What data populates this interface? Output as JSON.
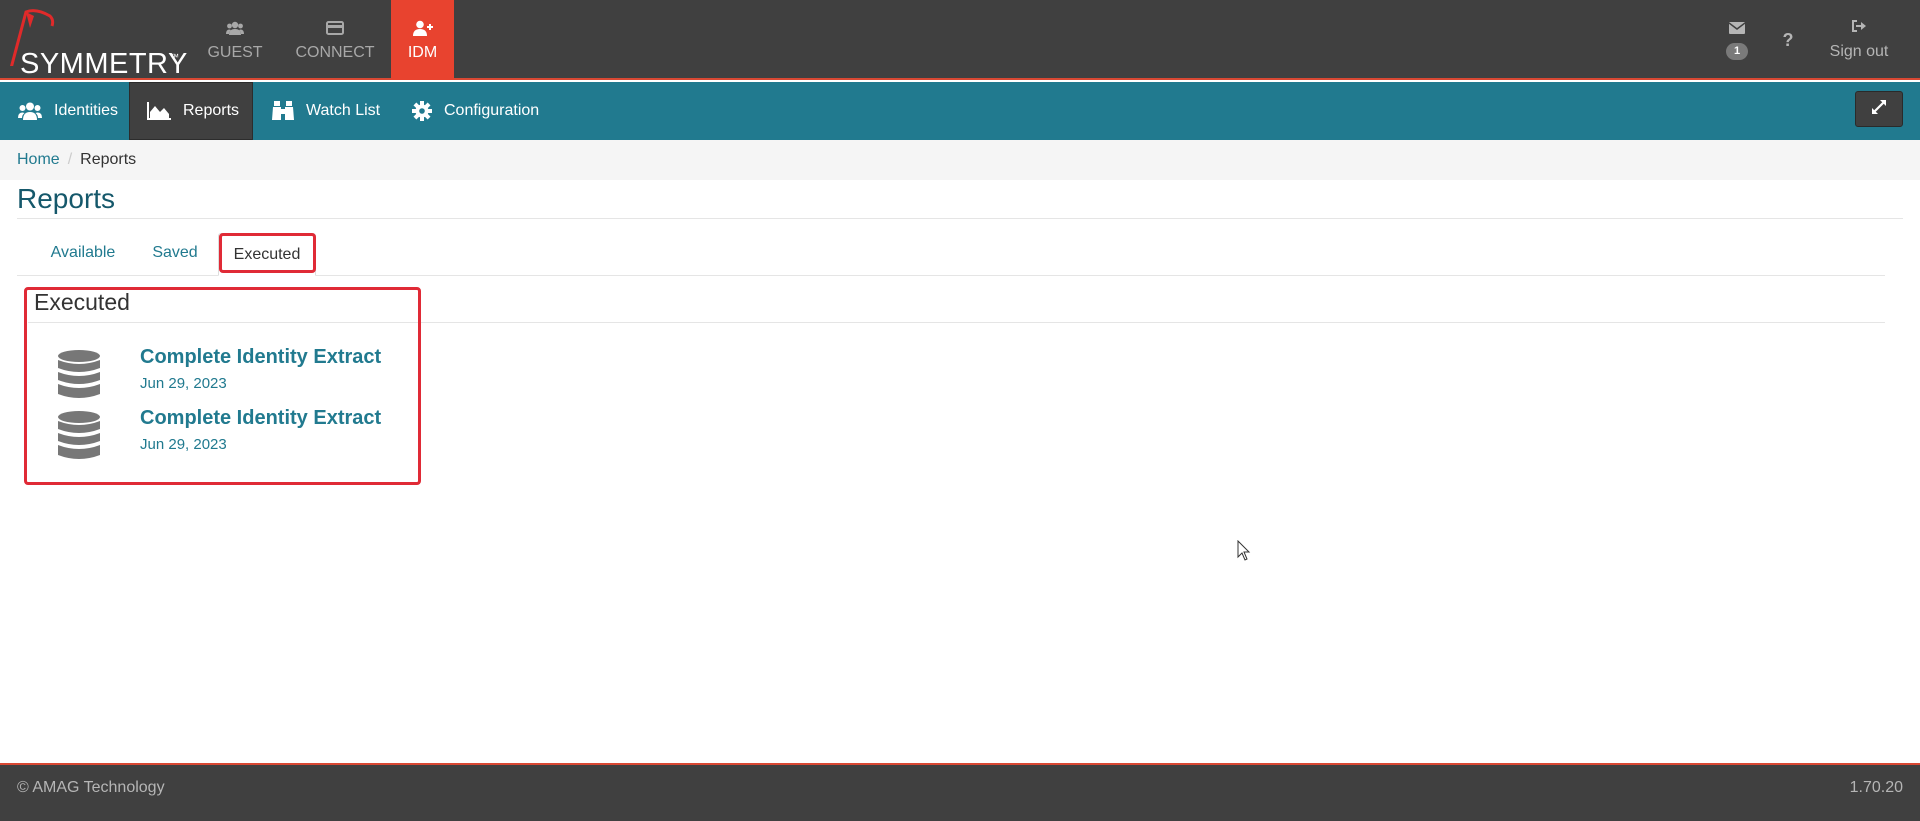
{
  "brand": {
    "name": "SYMMETRY",
    "tm": "™",
    "accent": "#d94833"
  },
  "app_tabs": [
    {
      "label": "GUEST",
      "icon": "users-icon",
      "active": false
    },
    {
      "label": "CONNECT",
      "icon": "card-icon",
      "active": false
    },
    {
      "label": "IDM",
      "icon": "user-plus-icon",
      "active": true
    }
  ],
  "top_right": {
    "messages_icon": "envelope-icon",
    "messages_count": "1",
    "help_label": "?",
    "signout_label": "Sign out",
    "signout_icon": "sign-out-icon"
  },
  "nav": {
    "items": [
      {
        "label": "Identities",
        "icon": "users-icon",
        "active": false
      },
      {
        "label": "Reports",
        "icon": "area-chart-icon",
        "active": true
      },
      {
        "label": "Watch List",
        "icon": "binoculars-icon",
        "active": false
      },
      {
        "label": "Configuration",
        "icon": "gear-icon",
        "active": false
      }
    ],
    "expand_icon": "expand-icon",
    "color": "#217a8f"
  },
  "breadcrumb": {
    "home": "Home",
    "separator": "/",
    "current": "Reports"
  },
  "page": {
    "title": "Reports"
  },
  "tabs": [
    {
      "label": "Available",
      "active": false
    },
    {
      "label": "Saved",
      "active": false
    },
    {
      "label": "Executed",
      "active": true
    }
  ],
  "section": {
    "title": "Executed",
    "items": [
      {
        "name": "Complete Identity Extract",
        "date": "Jun 29, 2023",
        "icon": "database-icon"
      },
      {
        "name": "Complete Identity Extract",
        "date": "Jun 29, 2023",
        "icon": "database-icon"
      }
    ]
  },
  "footer": {
    "copyright": "© AMAG Technology",
    "version": "1.70.20"
  }
}
